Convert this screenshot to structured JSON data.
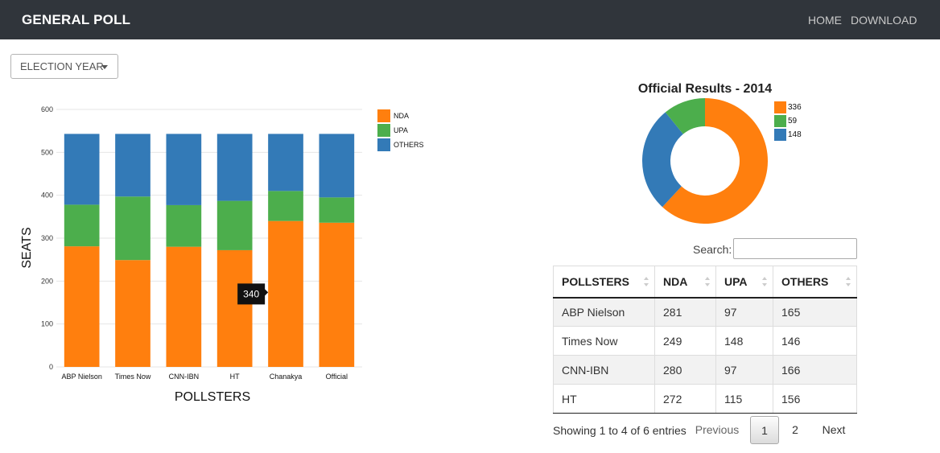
{
  "nav": {
    "brand": "GENERAL POLL",
    "home": "HOME",
    "download": "DOWNLOAD"
  },
  "filter": {
    "label": "ELECTION YEAR"
  },
  "colors": {
    "NDA": "#ff7f0e",
    "UPA": "#4cae4c",
    "OTHERS": "#337ab7"
  },
  "chart_data": [
    {
      "type": "bar",
      "stacked": true,
      "categories": [
        "ABP Nielson",
        "Times Now",
        "CNN-IBN",
        "HT",
        "Chanakya",
        "Official"
      ],
      "series": [
        {
          "name": "NDA",
          "values": [
            281,
            249,
            280,
            272,
            340,
            336
          ]
        },
        {
          "name": "UPA",
          "values": [
            97,
            148,
            97,
            115,
            70,
            59
          ]
        },
        {
          "name": "OTHERS",
          "values": [
            165,
            146,
            166,
            156,
            133,
            148
          ]
        }
      ],
      "xlabel": "POLLSTERS",
      "ylabel": "SEATS",
      "ylim": [
        0,
        600
      ],
      "yticks": [
        0,
        100,
        200,
        300,
        400,
        500,
        600
      ],
      "grid": true,
      "legend": "right",
      "tooltip": "340"
    },
    {
      "type": "pie",
      "donut": true,
      "title": "Official Results - 2014",
      "labels": [
        "336",
        "59",
        "148"
      ],
      "values": [
        336,
        59,
        148
      ],
      "legend": "right"
    }
  ],
  "search": {
    "label": "Search:",
    "value": ""
  },
  "table": {
    "columns": [
      "POLLSTERS",
      "NDA",
      "UPA",
      "OTHERS"
    ],
    "rows": [
      [
        "ABP Nielson",
        "281",
        "97",
        "165"
      ],
      [
        "Times Now",
        "249",
        "148",
        "146"
      ],
      [
        "CNN-IBN",
        "280",
        "97",
        "166"
      ],
      [
        "HT",
        "272",
        "115",
        "156"
      ]
    ]
  },
  "pagination": {
    "info": "Showing 1 to 4 of 6 entries",
    "previous": "Previous",
    "page1": "1",
    "page2": "2",
    "next": "Next"
  }
}
